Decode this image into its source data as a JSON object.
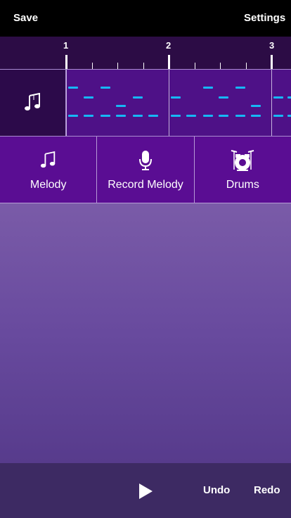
{
  "header": {
    "save_label": "Save",
    "settings_label": "Settings"
  },
  "timeline": {
    "measures": [
      "1",
      "2",
      "3"
    ]
  },
  "instruments": [
    {
      "label": "Melody",
      "icon": "music-notes-icon"
    },
    {
      "label": "Record Melody",
      "icon": "microphone-icon"
    },
    {
      "label": "Drums",
      "icon": "drum-kit-icon"
    }
  ],
  "footer": {
    "undo_label": "Undo",
    "redo_label": "Redo",
    "play_icon": "play-icon"
  },
  "colors": {
    "note": "#17b7f5",
    "topbar": "#000000",
    "track_panel": "#4e1187"
  }
}
